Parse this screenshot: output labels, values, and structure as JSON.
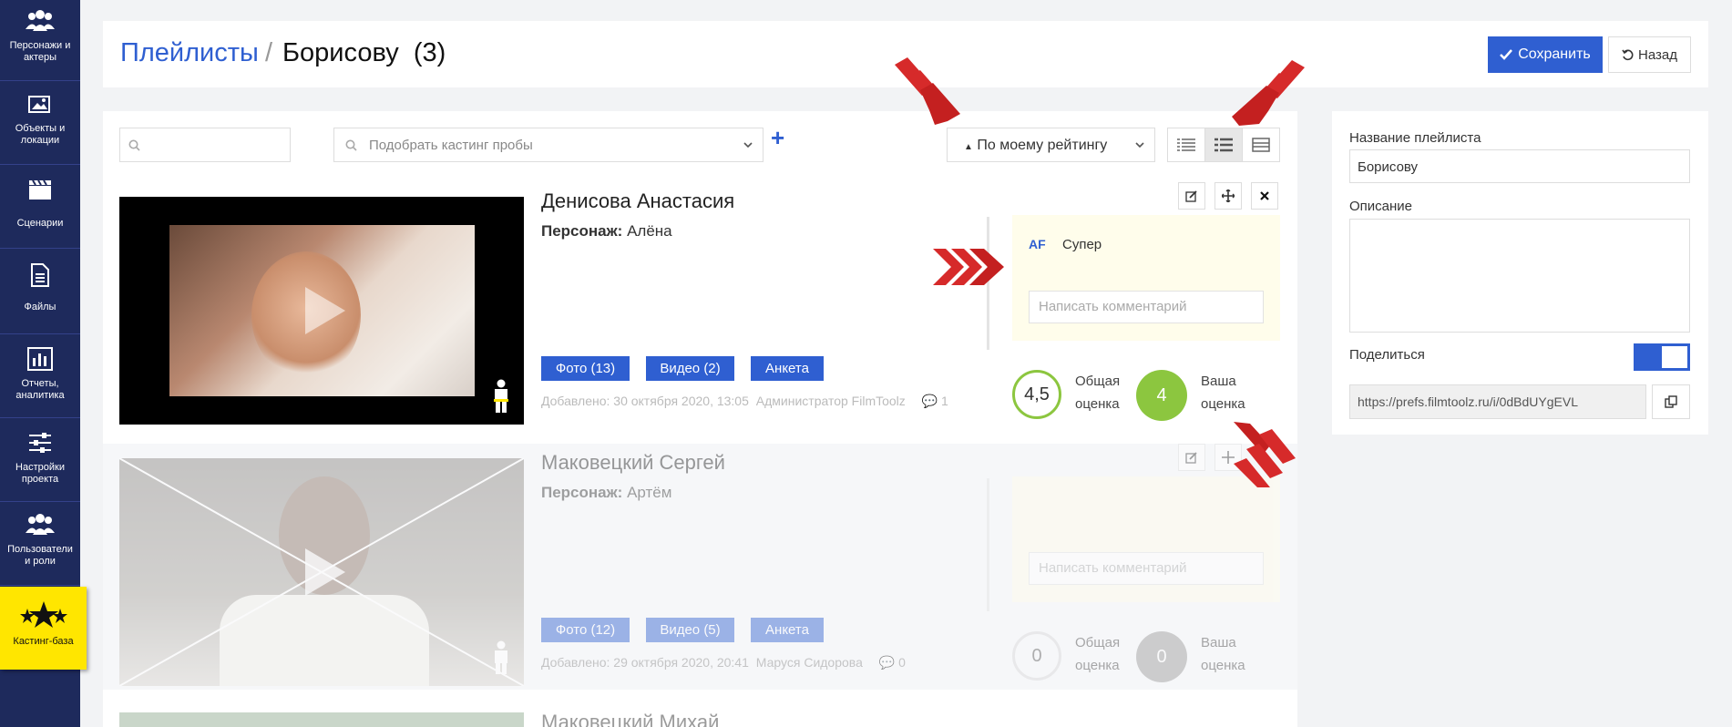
{
  "sidebar": {
    "items": [
      {
        "label": "Персонажи и актеры",
        "icon": "users-icon"
      },
      {
        "label": "Объекты и локации",
        "icon": "image-icon"
      },
      {
        "label": "Сценарии",
        "icon": "clapper-icon"
      },
      {
        "label": "Файлы",
        "icon": "file-icon"
      },
      {
        "label": "Отчеты, аналитика",
        "icon": "chart-icon"
      },
      {
        "label": "Настройки проекта",
        "icon": "sliders-icon"
      },
      {
        "label": "Пользователи и роли",
        "icon": "users-icon"
      },
      {
        "label": "Кастинг-база",
        "icon": "stars-icon",
        "active": true
      }
    ]
  },
  "header": {
    "breadcrumb_link": "Плейлисты",
    "breadcrumb_sep": "/",
    "title": "Борисову  (3)",
    "save_label": "Сохранить",
    "back_label": "Назад"
  },
  "toolbar": {
    "search_placeholder": "",
    "casting_placeholder": "Подобрать кастинг пробы",
    "sort_label": "По моему рейтингу"
  },
  "cards": [
    {
      "name": "Денисова Анастасия",
      "role_label": "Персонаж:",
      "role": "Алёна",
      "tags": [
        "Фото (13)",
        "Видео (2)",
        "Анкета"
      ],
      "added": "Добавлено: 30 октября 2020, 13:05",
      "author": "Администратор FilmToolz",
      "comments_count": "1",
      "comment_author": "AF",
      "comment_text": "Супер",
      "comment_placeholder": "Написать комментарий",
      "total_score": "4,5",
      "total_label_1": "Общая",
      "total_label_2": "оценка",
      "your_score": "4",
      "your_label_1": "Ваша",
      "your_label_2": "оценка"
    },
    {
      "name": "Маковецкий Сергей",
      "role_label": "Персонаж:",
      "role": "Артём",
      "tags": [
        "Фото (12)",
        "Видео (5)",
        "Анкета"
      ],
      "added": "Добавлено: 29 октября 2020, 20:41",
      "author": "Маруся Сидорова",
      "comments_count": "0",
      "comment_placeholder": "Написать комментарий",
      "total_score": "0",
      "total_label_1": "Общая",
      "total_label_2": "оценка",
      "your_score": "0",
      "your_label_1": "Ваша",
      "your_label_2": "оценка"
    },
    {
      "name": "Маковецкий Михай"
    }
  ],
  "right_panel": {
    "name_label": "Название плейлиста",
    "name_value": "Борисову",
    "desc_label": "Описание",
    "desc_value": "",
    "share_label": "Поделиться",
    "share_url": "https://prefs.filmtoolz.ru/i/0dBdUYgEVL"
  },
  "colors": {
    "sidebar_bg": "#1e2a5c",
    "accent": "#2f5fd1",
    "active_item": "#ffe600",
    "arrow_red": "#d62a2a",
    "score_green": "#8cc63f"
  }
}
